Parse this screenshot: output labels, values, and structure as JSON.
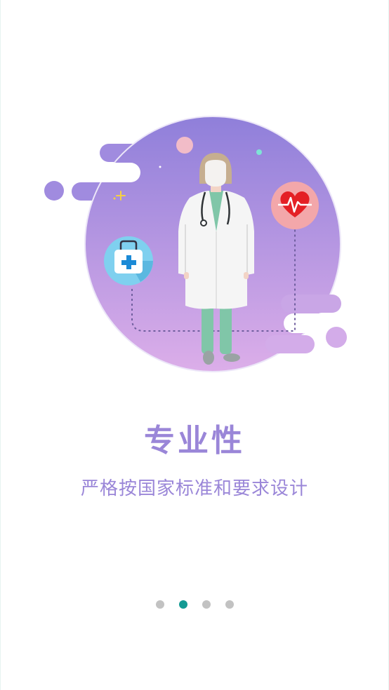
{
  "onboarding": {
    "title": "专业性",
    "subtitle": "严格按国家标准和要求设计"
  },
  "illustration": {
    "icons": [
      "doctor-figure",
      "medical-kit-icon",
      "heart-rate-icon",
      "stethoscope-icon"
    ]
  },
  "pager": {
    "page_count": 4,
    "active_index": 1,
    "active_color": "#139a93",
    "inactive_color": "#c2c2c2"
  },
  "colors": {
    "accent": "#9a86d8",
    "circle_top": "#8f7fda",
    "circle_bottom": "#dcaee9"
  }
}
